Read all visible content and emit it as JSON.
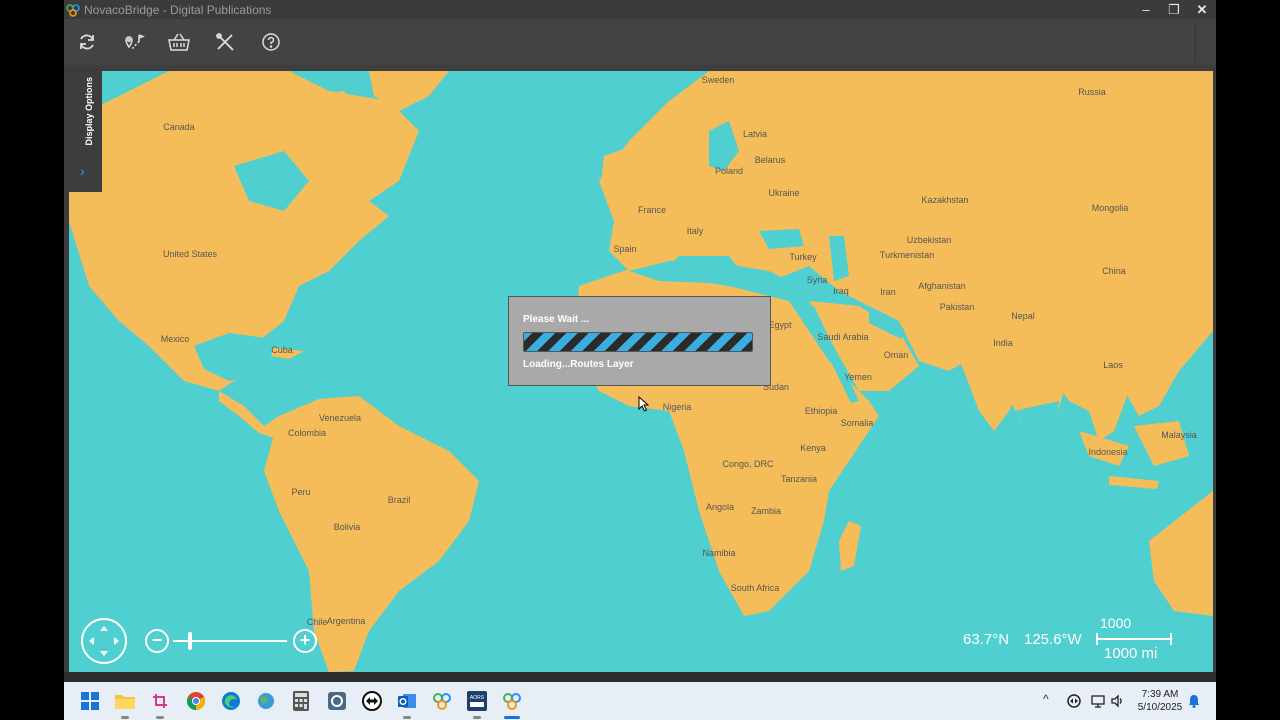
{
  "window": {
    "title": "NovacoBridge - Digital Publications",
    "buttons": {
      "minimize": "–",
      "restore": "❐",
      "close": "✕"
    }
  },
  "toolbar": {
    "items": [
      {
        "name": "refresh-icon"
      },
      {
        "name": "route-planner-icon"
      },
      {
        "name": "basket-icon"
      },
      {
        "name": "tools-icon"
      },
      {
        "name": "help-icon"
      }
    ]
  },
  "side_panel": {
    "label": "Display Options",
    "chevron": "›"
  },
  "dialog": {
    "title": "Please Wait ...",
    "status": "Loading...Routes Layer"
  },
  "map": {
    "colors": {
      "ocean": "#4fcfcf",
      "land": "#f5bd59",
      "label": "#555555"
    },
    "labels": [
      "Sweden",
      "Russia",
      "Canada",
      "Latvia",
      "Belarus",
      "Poland",
      "Ukraine",
      "Kazakhstan",
      "Mongolia",
      "France",
      "Italy",
      "Spain",
      "Uzbekistan",
      "Turkmenistan",
      "Turkey",
      "China",
      "United States",
      "Syria",
      "Iraq",
      "Iran",
      "Afghanistan",
      "Pakistan",
      "Nepal",
      "Egypt",
      "Saudi Arabia",
      "Oman",
      "India",
      "Mexico",
      "Cuba",
      "Yemen",
      "Laos",
      "Sudan",
      "Nigeria",
      "Venezuela",
      "Ethiopia",
      "Somalia",
      "Colombia",
      "Malaysia",
      "Kenya",
      "Indonesia",
      "Congo, DRC",
      "Tanzania",
      "Peru",
      "Brazil",
      "Angola",
      "Zambia",
      "Bolivia",
      "Namibia",
      "South Africa",
      "Chile",
      "Argentina"
    ],
    "latitude": "63.7°N",
    "longitude": "125.6°W",
    "scale_km": "1000",
    "scale_mi": "1000 mi",
    "zoom_level": 0.13
  },
  "taskbar": {
    "apps": [
      {
        "name": "start-icon"
      },
      {
        "name": "file-explorer-icon"
      },
      {
        "name": "snipping-tool-icon"
      },
      {
        "name": "chrome-icon"
      },
      {
        "name": "edge-icon"
      },
      {
        "name": "maps-icon"
      },
      {
        "name": "calculator-icon"
      },
      {
        "name": "settings-app-icon"
      },
      {
        "name": "teamviewer-icon"
      },
      {
        "name": "outlook-icon"
      },
      {
        "name": "novaco-icon"
      },
      {
        "name": "aors-icon"
      },
      {
        "name": "novacobridge-icon"
      }
    ],
    "aors_label": "AORS",
    "tray": {
      "chevron": "^",
      "time": "7:39 AM",
      "date": "5/10/2025"
    }
  }
}
